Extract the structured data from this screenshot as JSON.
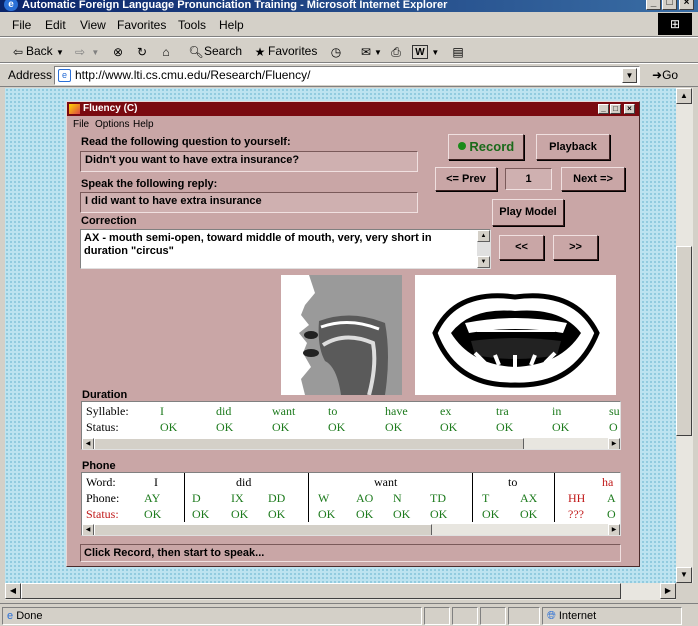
{
  "window": {
    "title": "Automatic Foreign Language Pronunciation Training - Microsoft Internet Explorer"
  },
  "menu": [
    "File",
    "Edit",
    "View",
    "Favorites",
    "Tools",
    "Help"
  ],
  "toolbar": {
    "back": "Back",
    "search": "Search",
    "favorites": "Favorites"
  },
  "address": {
    "label": "Address",
    "url": "http://www.lti.cs.cmu.edu/Research/Fluency/",
    "go": "Go"
  },
  "status": {
    "text": "Done",
    "zone": "Internet"
  },
  "fluency": {
    "title": "Fluency (C)",
    "menu": [
      "File",
      "Options",
      "Help"
    ],
    "question_label": "Read the following question to yourself:",
    "question": "Didn't you want to have extra insurance?",
    "reply_label": "Speak the following reply:",
    "reply": "I did want to have extra insurance",
    "correction_label": "Correction",
    "correction": "AX - mouth semi-open, toward middle of mouth, very, very short in duration  \"circus\"",
    "record": "Record",
    "playback": "Playback",
    "prev": "<= Prev",
    "counter": "1",
    "next": "Next =>",
    "play_model": "Play Model",
    "rewind": "<<",
    "forward": ">>",
    "duration_label": "Duration",
    "duration": {
      "syllable_label": "Syllable:",
      "status_label": "Status:",
      "syllables": [
        "I",
        "did",
        "want",
        "to",
        "have",
        "ex",
        "tra",
        "in",
        "su"
      ],
      "statuses": [
        "OK",
        "OK",
        "OK",
        "OK",
        "OK",
        "OK",
        "OK",
        "OK",
        "O"
      ]
    },
    "phone_label": "Phone",
    "phone": {
      "word_label": "Word:",
      "phone_label": "Phone:",
      "status_label": "Status:",
      "words": [
        "I",
        "did",
        "want",
        "to",
        "ha"
      ],
      "phones": [
        "AY",
        "D",
        "IX",
        "DD",
        "W",
        "AO",
        "N",
        "TD",
        "T",
        "AX",
        "HH",
        "A"
      ],
      "statuses": [
        "OK",
        "OK",
        "OK",
        "OK",
        "OK",
        "OK",
        "OK",
        "OK",
        "OK",
        "OK",
        "???",
        "O"
      ]
    },
    "status": "Click Record, then start to speak...",
    "colors": {
      "ok": "#1c7a1c",
      "error": "#c01818",
      "record_dot": "#1a8a1a"
    }
  }
}
